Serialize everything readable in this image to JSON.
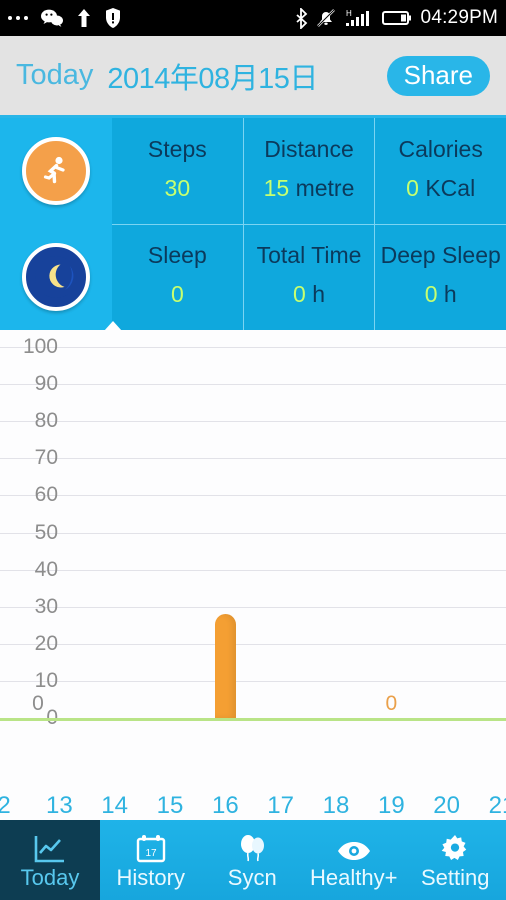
{
  "statusbar": {
    "icons_left": [
      "more-dots-icon",
      "wechat-icon",
      "upload-arrow-icon",
      "security-shield-icon"
    ],
    "icons_right": [
      "bluetooth-icon",
      "silent-bell-icon",
      "signal-bars-icon",
      "battery-icon"
    ],
    "network_type": "H",
    "time": "04:29PM"
  },
  "header": {
    "today_label": "Today",
    "date": "2014年08月15日",
    "share_label": "Share"
  },
  "stats": {
    "activity": {
      "icon": "running-person-icon",
      "cells": [
        {
          "label": "Steps",
          "value": "30",
          "unit": ""
        },
        {
          "label": "Distance",
          "value": "15",
          "unit": " metre"
        },
        {
          "label": "Calories",
          "value": "0",
          "unit": " KCal"
        }
      ]
    },
    "sleep": {
      "icon": "crescent-moon-icon",
      "cells": [
        {
          "label": "Sleep",
          "value": "0",
          "unit": ""
        },
        {
          "label": "Total Time",
          "value": "0",
          "unit": " h"
        },
        {
          "label": "Deep Sleep",
          "value": "0",
          "unit": " h"
        }
      ]
    }
  },
  "chart_data": {
    "type": "bar",
    "title": "",
    "xlabel": "",
    "ylabel": "",
    "ylim": [
      0,
      100
    ],
    "yticks": [
      0,
      10,
      20,
      30,
      40,
      50,
      60,
      70,
      80,
      90,
      100
    ],
    "categories": [
      "2",
      "13",
      "14",
      "15",
      "16",
      "17",
      "18",
      "19",
      "20",
      "21"
    ],
    "values": [
      0,
      0,
      0,
      0,
      28,
      0,
      0,
      0,
      0,
      0
    ],
    "point_labels": [
      {
        "category": "2",
        "text": "0"
      },
      {
        "category": "19",
        "text": "0"
      }
    ],
    "grid": true,
    "legend": "none",
    "bar_color": "#f49f33",
    "axis_color": "#b9e487",
    "tick_color": "#2fb3e0"
  },
  "nav": {
    "items": [
      {
        "label": "Today",
        "icon": "chart-line-icon",
        "active": true
      },
      {
        "label": "History",
        "icon": "calendar-icon",
        "active": false
      },
      {
        "label": "Sycn",
        "icon": "balloons-icon",
        "active": false
      },
      {
        "label": "Healthy+",
        "icon": "eye-icon",
        "active": false
      },
      {
        "label": "Setting",
        "icon": "gear-icon",
        "active": false
      }
    ]
  },
  "colors": {
    "accent": "#29b6e8",
    "stats_bg": "#0fa8dd",
    "value_green": "#c6ff70",
    "bar_orange": "#f49f33",
    "nav_active_bg": "#0d3d52"
  }
}
